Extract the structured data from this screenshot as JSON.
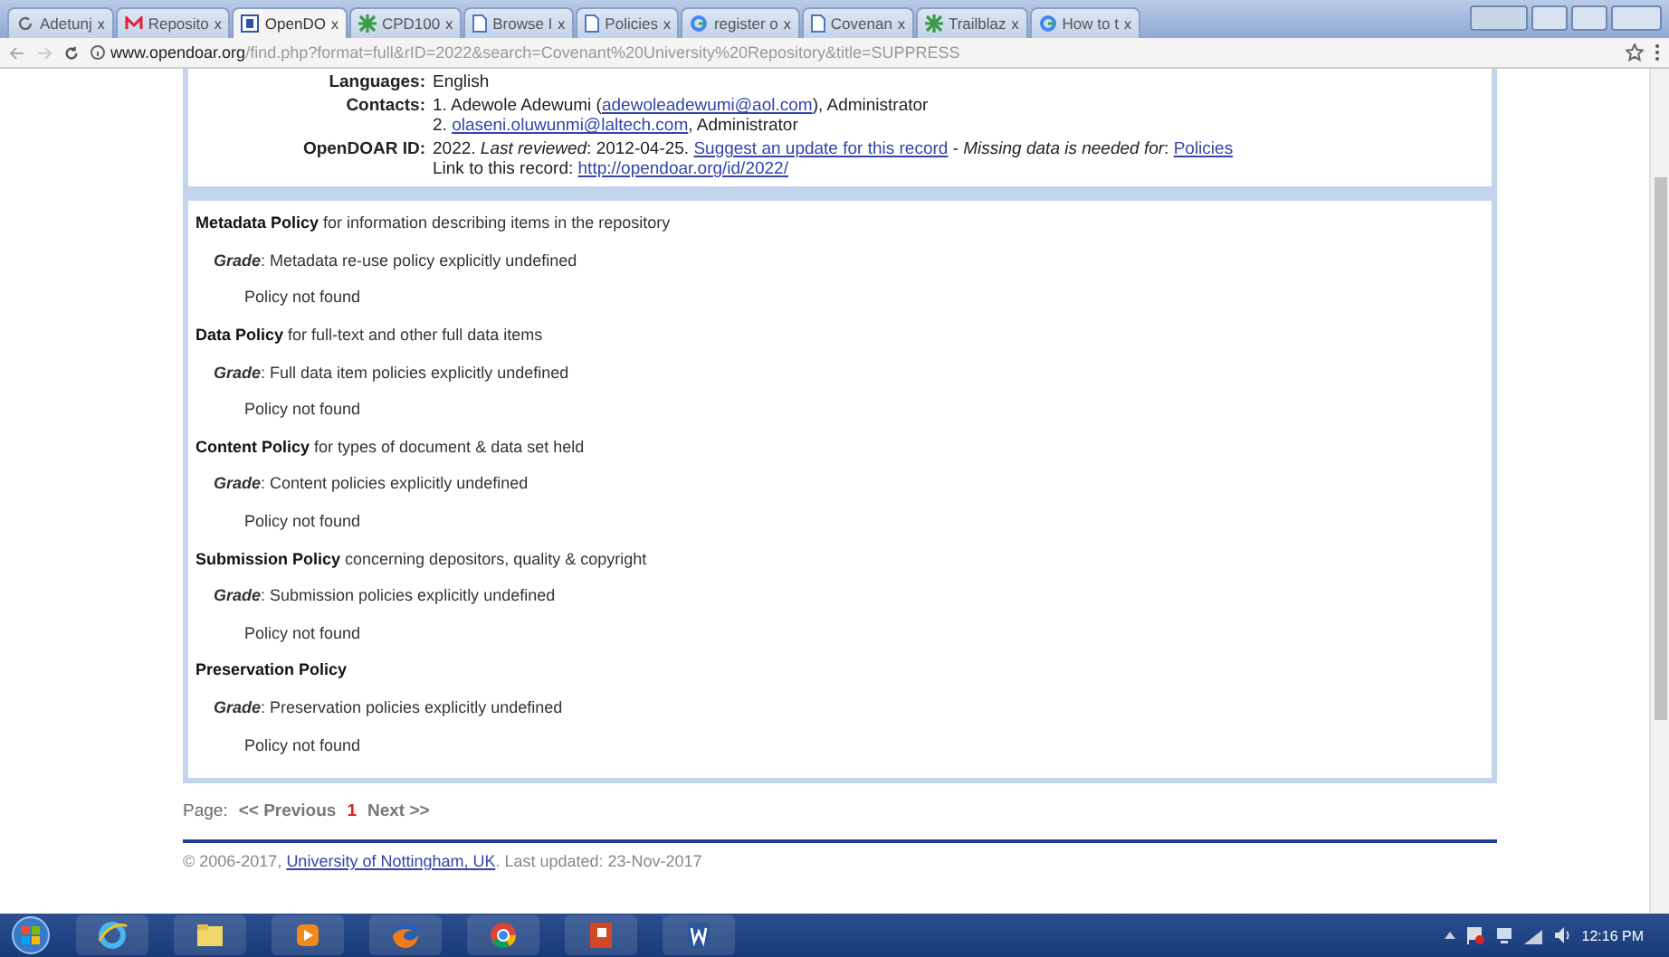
{
  "browser": {
    "tabs": [
      {
        "label": "Adetunj",
        "kind": "reload",
        "close": "x",
        "selected": false
      },
      {
        "label": "Reposito",
        "kind": "mail",
        "close": "x",
        "selected": false
      },
      {
        "label": "OpenDO",
        "kind": "doc",
        "close": "x",
        "selected": true
      },
      {
        "label": "CPD100",
        "kind": "star",
        "close": "x",
        "selected": false
      },
      {
        "label": "Browse I",
        "kind": "page",
        "close": "x",
        "selected": false
      },
      {
        "label": "Policies",
        "kind": "page",
        "close": "x",
        "selected": false
      },
      {
        "label": "register o",
        "kind": "google",
        "close": "x",
        "selected": false
      },
      {
        "label": "Covenan",
        "kind": "page",
        "close": "x",
        "selected": false
      },
      {
        "label": "Trailblaz",
        "kind": "star",
        "close": "x",
        "selected": false
      },
      {
        "label": "How to t",
        "kind": "google",
        "close": "x",
        "selected": false
      }
    ],
    "url_host": "www.opendoar.org",
    "url_path": "/find.php?format=full&rID=2022&search=Covenant%20University%20Repository&title=SUPPRESS"
  },
  "record": [
    {
      "label": "Languages:",
      "lines": [
        [
          {
            "text": "English"
          }
        ]
      ]
    },
    {
      "label": "Contacts:",
      "lines": [
        [
          {
            "text": "1. Adewole Adewumi ("
          },
          {
            "text": "adewoleadewumi@aol.com",
            "link": true
          },
          {
            "text": "), Administrator"
          }
        ],
        [
          {
            "text": "2. "
          },
          {
            "text": "olaseni.oluwunmi@laltech.com",
            "link": true
          },
          {
            "text": ", Administrator"
          }
        ]
      ]
    },
    {
      "label": "OpenDOAR ID:",
      "lines": [
        [
          {
            "text": "2022. *Last reviewed*: 2012-04-25. "
          },
          {
            "text": "Suggest an update for this record",
            "link": true
          },
          {
            "text": " - *Missing data is needed for*: "
          },
          {
            "text": "Policies",
            "link": true
          }
        ],
        [
          {
            "text": "Link to this record: "
          },
          {
            "text": "http://opendoar.org/id/2022/",
            "link": true
          }
        ]
      ]
    }
  ],
  "policies": [
    {
      "title": "Metadata Policy",
      "description": "for information describing items in the repository",
      "grade_label": "Grade",
      "grade": ": Metadata re-use policy explicitly undefined",
      "note": "Policy not found"
    },
    {
      "title": "Data Policy",
      "description": "for full-text and other full data items",
      "grade_label": "Grade",
      "grade": ": Full data item policies explicitly undefined",
      "note": "Policy not found"
    },
    {
      "title": "Content Policy",
      "description": "for types of document & data set held",
      "grade_label": "Grade",
      "grade": ": Content policies explicitly undefined",
      "note": "Policy not found"
    },
    {
      "title": "Submission Policy",
      "description": "concerning depositors, quality & copyright",
      "grade_label": "Grade",
      "grade": ": Submission policies explicitly undefined",
      "note": "Policy not found"
    },
    {
      "title": "Preservation Policy",
      "grade_label": "Grade",
      "grade": ": Preservation policies explicitly undefined",
      "note": "Policy not found"
    }
  ],
  "pager": {
    "label": "Page:",
    "previous": "<< Previous",
    "current": "1",
    "next": "Next >>"
  },
  "footer": {
    "copyright": "© 2006-2017,",
    "link": "University of Nottingham, UK",
    "updated": ". Last updated: 23-Nov-2017"
  },
  "taskbar": {
    "apps": [
      {
        "kind": "ie"
      },
      {
        "kind": "folder"
      },
      {
        "kind": "media"
      },
      {
        "kind": "firefox"
      },
      {
        "kind": "chrome"
      },
      {
        "kind": "powerpoint"
      },
      {
        "kind": "word"
      }
    ],
    "time": "12:16 PM"
  }
}
